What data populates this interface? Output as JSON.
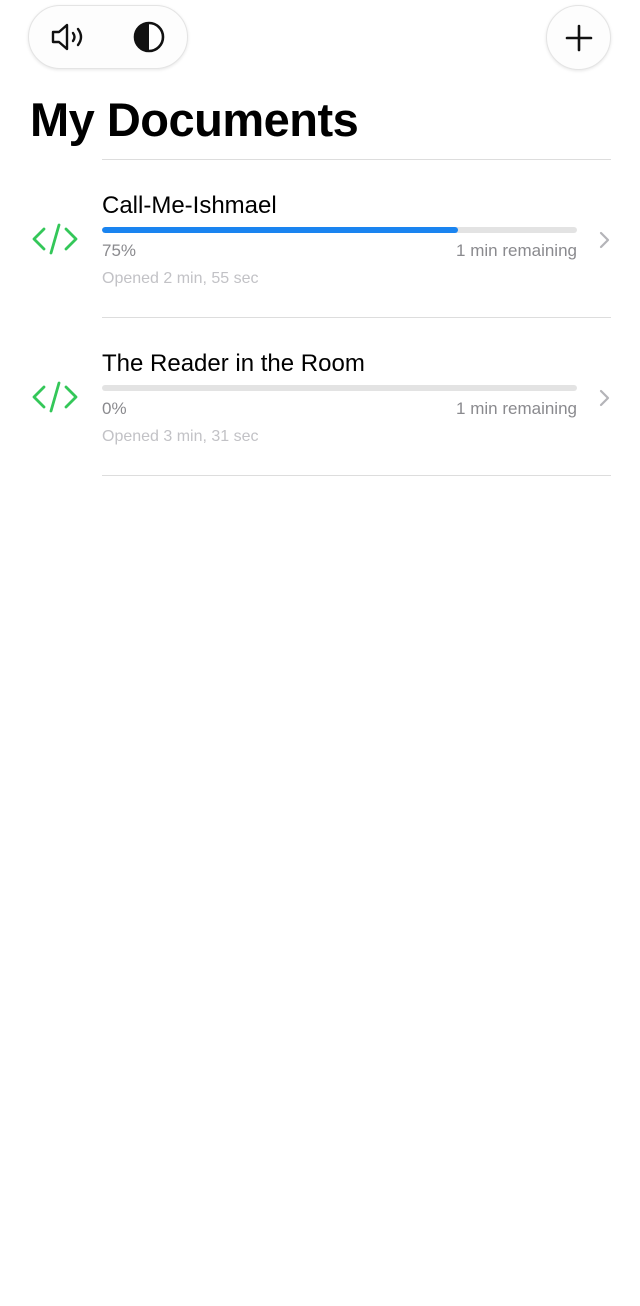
{
  "toolbar": {
    "speaker_icon": "speaker-icon",
    "contrast_icon": "contrast-icon",
    "add_icon": "plus-icon"
  },
  "page_title": "My Documents",
  "accent_colors": {
    "progress": "#1a84f0",
    "code_icon": "#34c759"
  },
  "documents": [
    {
      "title": "Call-Me-Ishmael",
      "percent_label": "75%",
      "progress": 0.75,
      "remaining": "1 min remaining",
      "opened": "Opened 2 min, 55 sec",
      "icon": "code-icon"
    },
    {
      "title": "The Reader in the Room",
      "percent_label": "0%",
      "progress": 0,
      "remaining": "1 min remaining",
      "opened": "Opened 3 min, 31 sec",
      "icon": "code-icon"
    }
  ]
}
